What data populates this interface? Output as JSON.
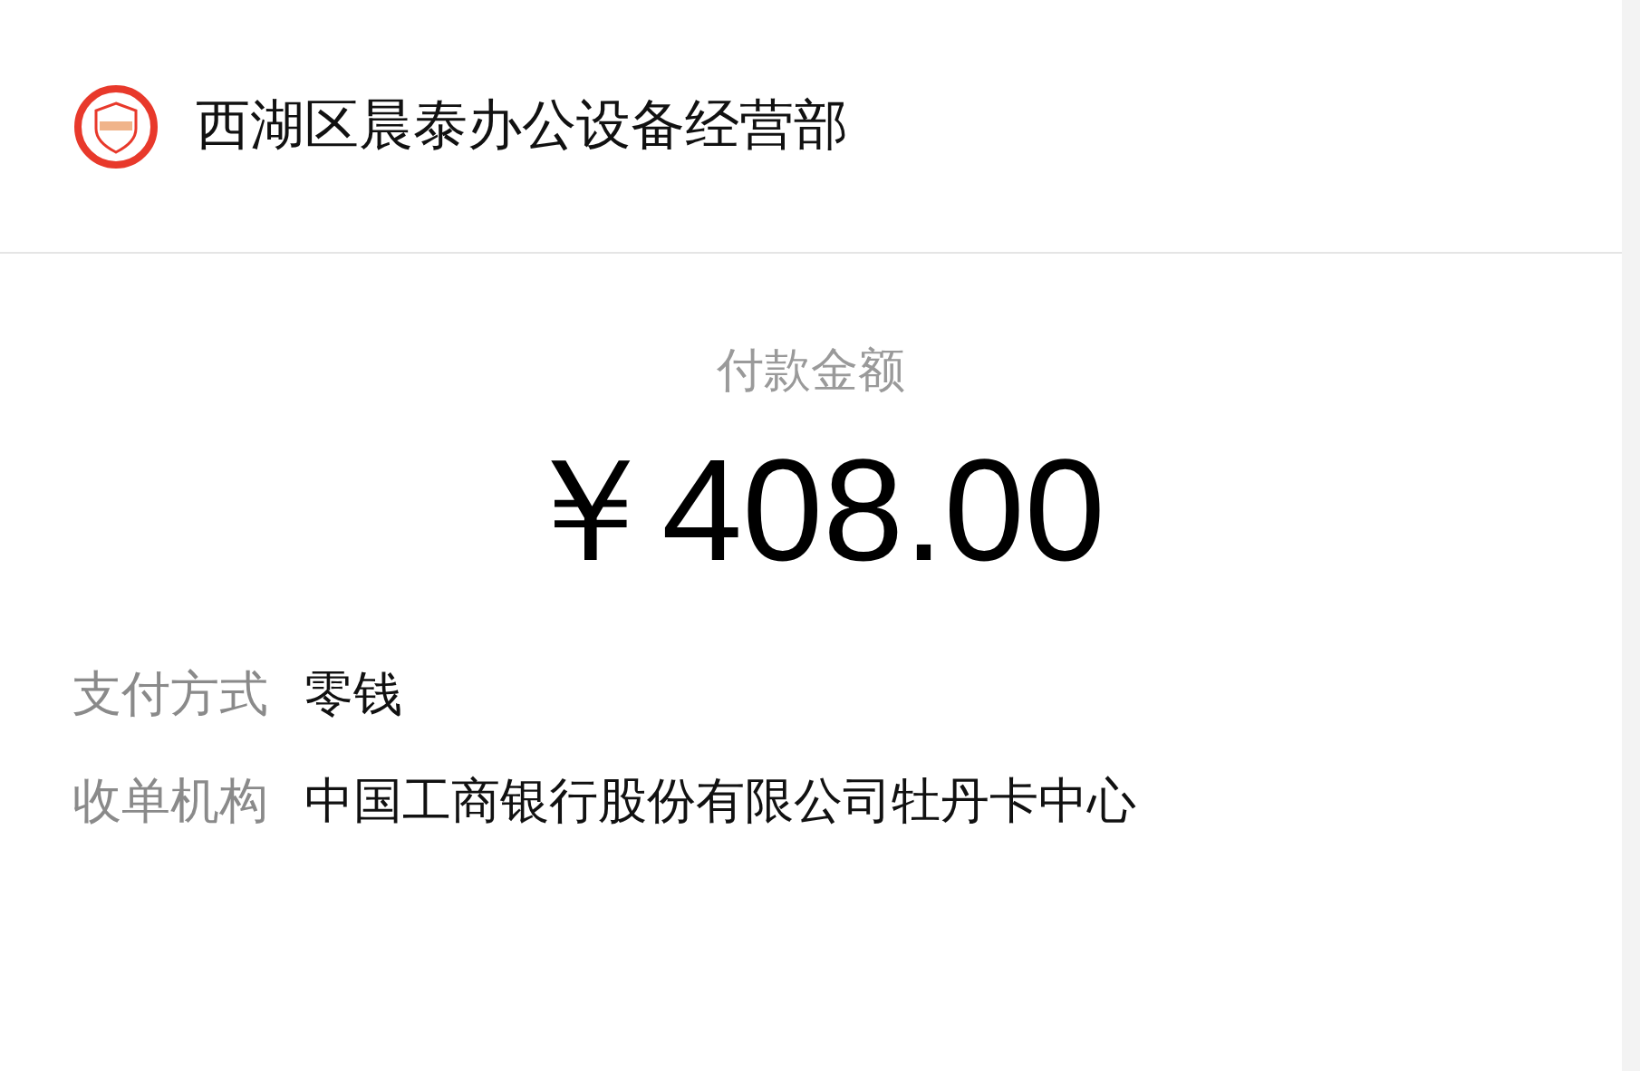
{
  "merchant": {
    "name": "西湖区晨泰办公设备经营部"
  },
  "payment": {
    "label": "付款金额",
    "amount": "￥408.00"
  },
  "details": [
    {
      "label": "支付方式",
      "value": "零钱"
    },
    {
      "label": "收单机构",
      "value": "中国工商银行股份有限公司牡丹卡中心"
    }
  ]
}
